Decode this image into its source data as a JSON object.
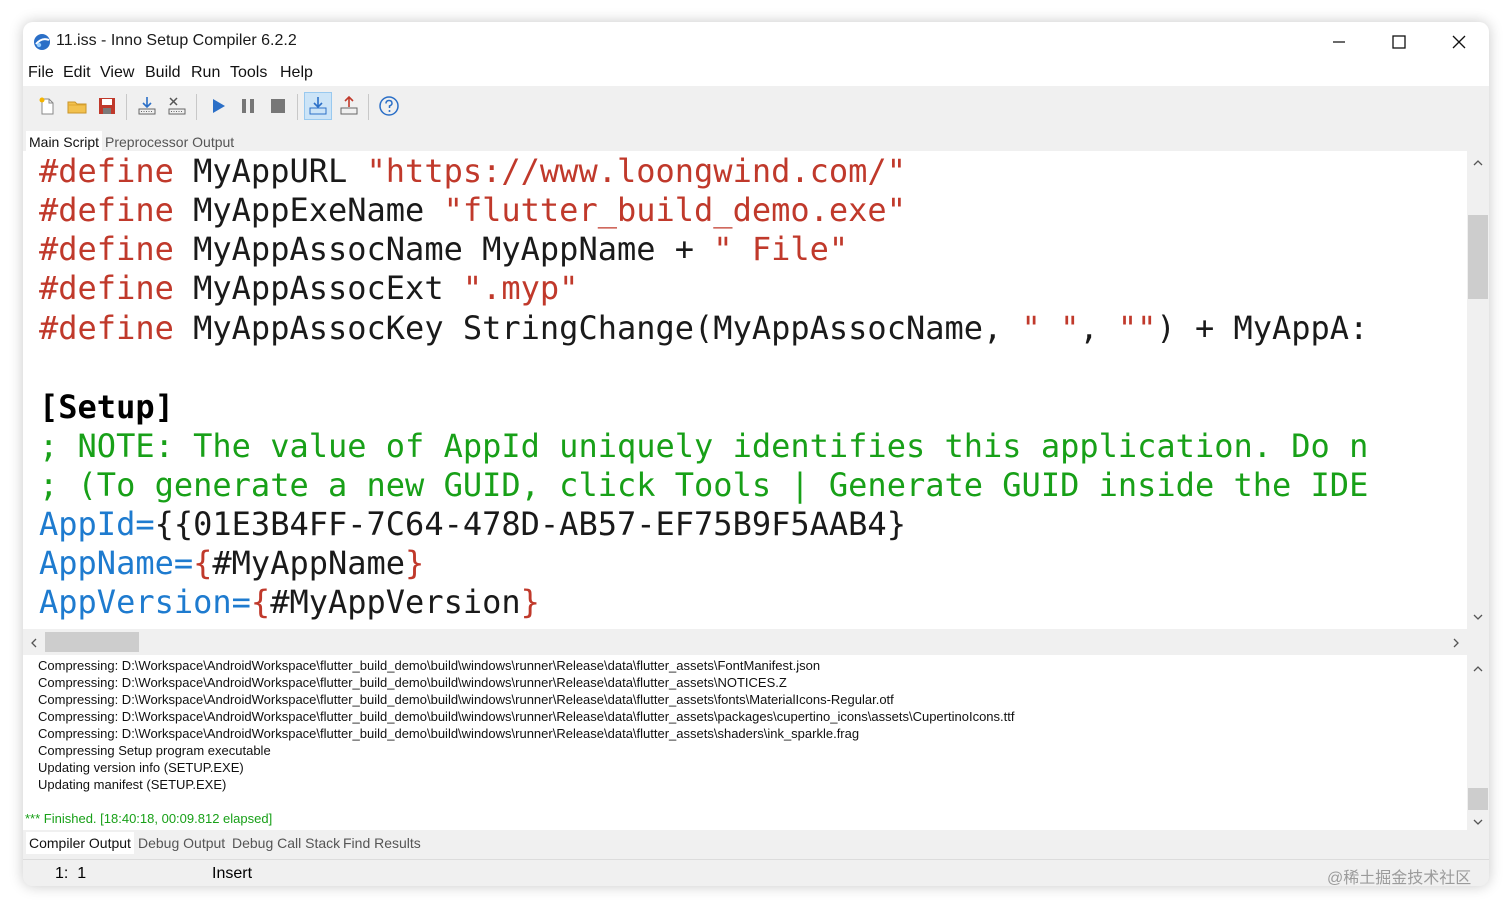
{
  "window": {
    "title": "11.iss - Inno Setup Compiler 6.2.2"
  },
  "menu": [
    "File",
    "Edit",
    "View",
    "Build",
    "Run",
    "Tools",
    "Help"
  ],
  "toolbar_icons": [
    "new-file-icon",
    "open-folder-icon",
    "save-icon",
    "compile-icon",
    "stop-compile-icon",
    "run-icon",
    "pause-icon",
    "terminate-icon",
    "target-install-icon",
    "target-uninstall-icon",
    "help-icon"
  ],
  "editor_tabs": [
    "Main Script",
    "Preprocessor Output"
  ],
  "code": {
    "l1": {
      "kw": "#define",
      "name": "MyAppURL",
      "val": "\"https://www.loongwind.com/\""
    },
    "l2": {
      "kw": "#define",
      "name": "MyAppExeName",
      "val": "\"flutter_build_demo.exe\""
    },
    "l3": {
      "kw": "#define",
      "name": "MyAppAssocName",
      "mid": "MyAppName + ",
      "val": "\" File\""
    },
    "l4": {
      "kw": "#define",
      "name": "MyAppAssocExt",
      "val": "\".myp\""
    },
    "l5": {
      "kw": "#define",
      "name": "MyAppAssocKey",
      "mid": "StringChange(MyAppAssocName, ",
      "s1": "\" \"",
      "comma": ", ",
      "s2": "\"\"",
      "rest": ") + MyAppA:"
    },
    "section": "[Setup]",
    "comment1": "; NOTE: The value of AppId uniquely identifies this application. Do n",
    "comment2": "; (To generate a new GUID, click Tools | Generate GUID inside the IDE",
    "appid": {
      "key": "AppId",
      "eq": "=",
      "val": "{{01E3B4FF-7C64-478D-AB57-EF75B9F5AAB4}"
    },
    "appname": {
      "key": "AppName",
      "eq": "=",
      "open": "{",
      "val": "#MyAppName",
      "close": "}"
    },
    "appversion": {
      "key": "AppVersion",
      "eq": "=",
      "open": "{",
      "val": "#MyAppVersion",
      "close": "}"
    }
  },
  "output_lines": [
    "Compressing: D:\\Workspace\\AndroidWorkspace\\flutter_build_demo\\build\\windows\\runner\\Release\\data\\flutter_assets\\FontManifest.json",
    "Compressing: D:\\Workspace\\AndroidWorkspace\\flutter_build_demo\\build\\windows\\runner\\Release\\data\\flutter_assets\\NOTICES.Z",
    "Compressing: D:\\Workspace\\AndroidWorkspace\\flutter_build_demo\\build\\windows\\runner\\Release\\data\\flutter_assets\\fonts\\MaterialIcons-Regular.otf",
    "Compressing: D:\\Workspace\\AndroidWorkspace\\flutter_build_demo\\build\\windows\\runner\\Release\\data\\flutter_assets\\packages\\cupertino_icons\\assets\\CupertinoIcons.ttf",
    "Compressing: D:\\Workspace\\AndroidWorkspace\\flutter_build_demo\\build\\windows\\runner\\Release\\data\\flutter_assets\\shaders\\ink_sparkle.frag",
    "Compressing Setup program executable",
    "Updating version info (SETUP.EXE)",
    "Updating manifest (SETUP.EXE)"
  ],
  "output_finished": "*** Finished.  [18:40:18, 00:09.812 elapsed]",
  "output_tabs": [
    "Compiler Output",
    "Debug Output",
    "Debug Call Stack",
    "Find Results"
  ],
  "status": {
    "position": "1:  1",
    "mode": "Insert"
  },
  "watermark": "@稀土掘金技术社区",
  "colors": {
    "preprocessor": "#c0392b",
    "comment": "#18a018",
    "key": "#1e7bcf",
    "finished": "#18a018"
  }
}
